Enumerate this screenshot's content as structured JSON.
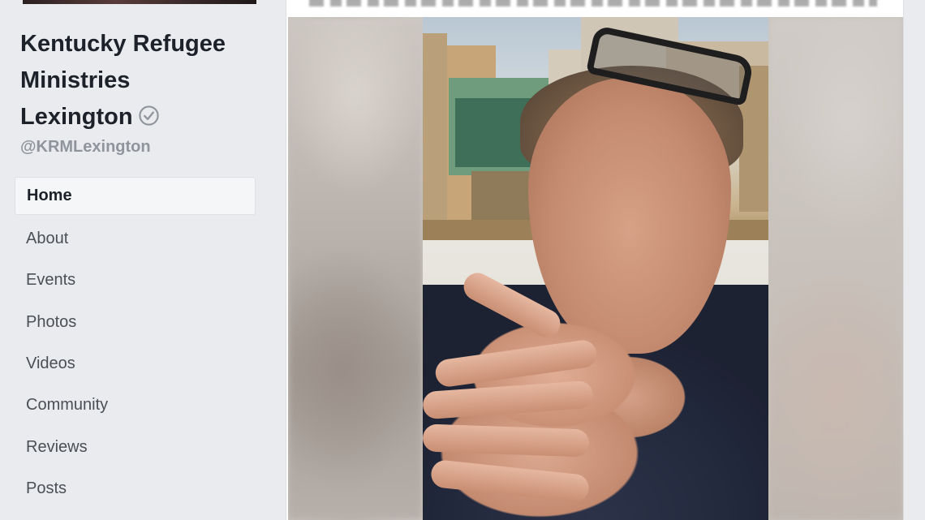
{
  "page": {
    "name_lines": [
      "Kentucky Refugee",
      "Ministries",
      "Lexington"
    ],
    "handle": "@KRMLexington",
    "verified_icon": "verified-check-icon"
  },
  "nav": {
    "items": [
      {
        "label": "Home",
        "active": true
      },
      {
        "label": "About"
      },
      {
        "label": "Events"
      },
      {
        "label": "Photos"
      },
      {
        "label": "Videos"
      },
      {
        "label": "Community"
      },
      {
        "label": "Reviews"
      },
      {
        "label": "Posts"
      }
    ]
  },
  "colors": {
    "page_bg": "#e9ebee",
    "card_bg": "#ffffff",
    "nav_text": "#4b4f56",
    "handle_text": "#90949c"
  }
}
